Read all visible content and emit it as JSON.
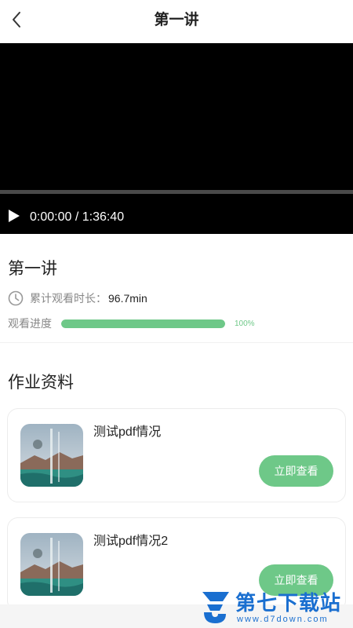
{
  "header": {
    "title": "第一讲"
  },
  "video": {
    "time_display": "0:00:00 / 1:36:40"
  },
  "lesson": {
    "title": "第一讲",
    "watch_label": "累计观看时长：",
    "watch_value": "96.7min",
    "progress_label": "观看进度",
    "progress_percent": 100,
    "progress_text": "100%"
  },
  "materials": {
    "section_title": "作业资料",
    "items": [
      {
        "title": "测试pdf情况",
        "button_label": "立即查看"
      },
      {
        "title": "测试pdf情况2",
        "button_label": "立即查看"
      }
    ]
  },
  "watermark": {
    "brand": "第七下载站",
    "url": "www.d7down.com"
  },
  "colors": {
    "accent_green": "#6ec888",
    "watermark_blue": "#1a6fd0"
  },
  "icons": {
    "back": "chevron-left-icon",
    "play": "play-icon",
    "clock": "clock-icon",
    "thumbnail": "document-thumbnail-image"
  }
}
